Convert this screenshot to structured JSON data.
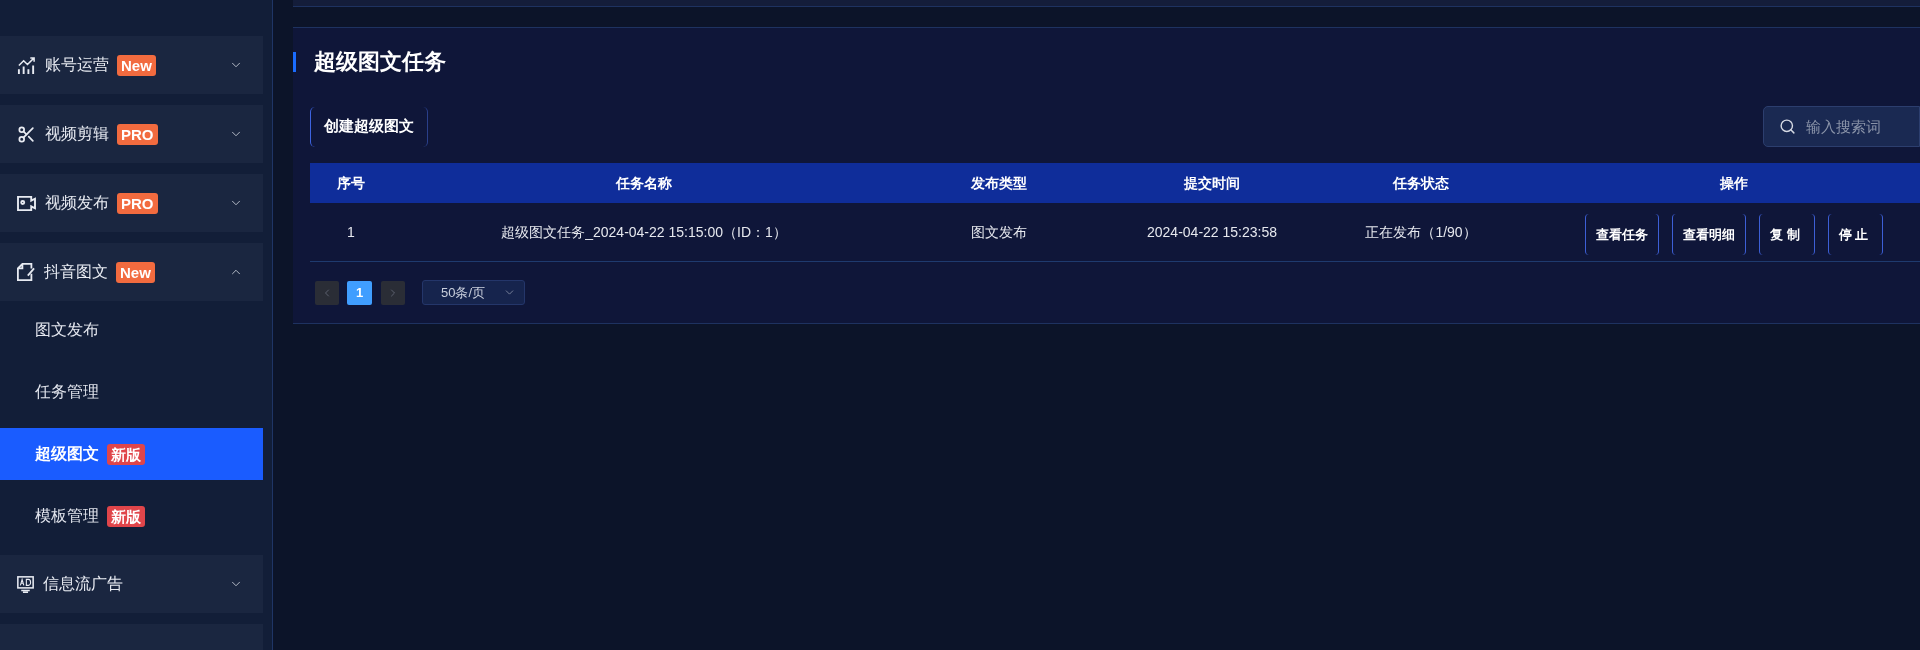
{
  "sidebar": {
    "menu": [
      {
        "label": "账号运营",
        "badge": {
          "text": "New",
          "color": "#f26b3f"
        },
        "expanded": false
      },
      {
        "label": "视频剪辑",
        "badge": {
          "text": "PRO",
          "color": "#f26b3f"
        },
        "expanded": false
      },
      {
        "label": "视频发布",
        "badge": {
          "text": "PRO",
          "color": "#f26b3f"
        },
        "expanded": false
      },
      {
        "label": "抖音图文",
        "badge": {
          "text": "New",
          "color": "#f26b3f"
        },
        "expanded": true,
        "children": [
          {
            "label": "图文发布",
            "selected": false
          },
          {
            "label": "任务管理",
            "selected": false
          },
          {
            "label": "超级图文",
            "badge": {
              "text": "新版",
              "color": "#e0454a"
            },
            "selected": true
          },
          {
            "label": "模板管理",
            "badge": {
              "text": "新版",
              "color": "#e0454a"
            },
            "selected": false
          }
        ]
      },
      {
        "label": "信息流广告",
        "expanded": false
      }
    ]
  },
  "page": {
    "title": "超级图文任务",
    "create_button": "创建超级图文",
    "search": {
      "placeholder": "输入搜索词"
    },
    "table": {
      "columns": [
        "序号",
        "任务名称",
        "发布类型",
        "提交时间",
        "任务状态",
        "操作"
      ],
      "rows": [
        {
          "cells": [
            "1",
            "超级图文任务_2024-04-22 15:15:00（ID：1）",
            "图文发布",
            "2024-04-22 15:23:58",
            "正在发布（1/90）"
          ],
          "actions": [
            "查看任务",
            "查看明细",
            "复制",
            "停止"
          ]
        }
      ]
    },
    "pagination": {
      "prev_disabled": true,
      "next_disabled": true,
      "pages": [
        {
          "label": "1",
          "selected": true
        }
      ],
      "page_size": "50条/页"
    }
  }
}
